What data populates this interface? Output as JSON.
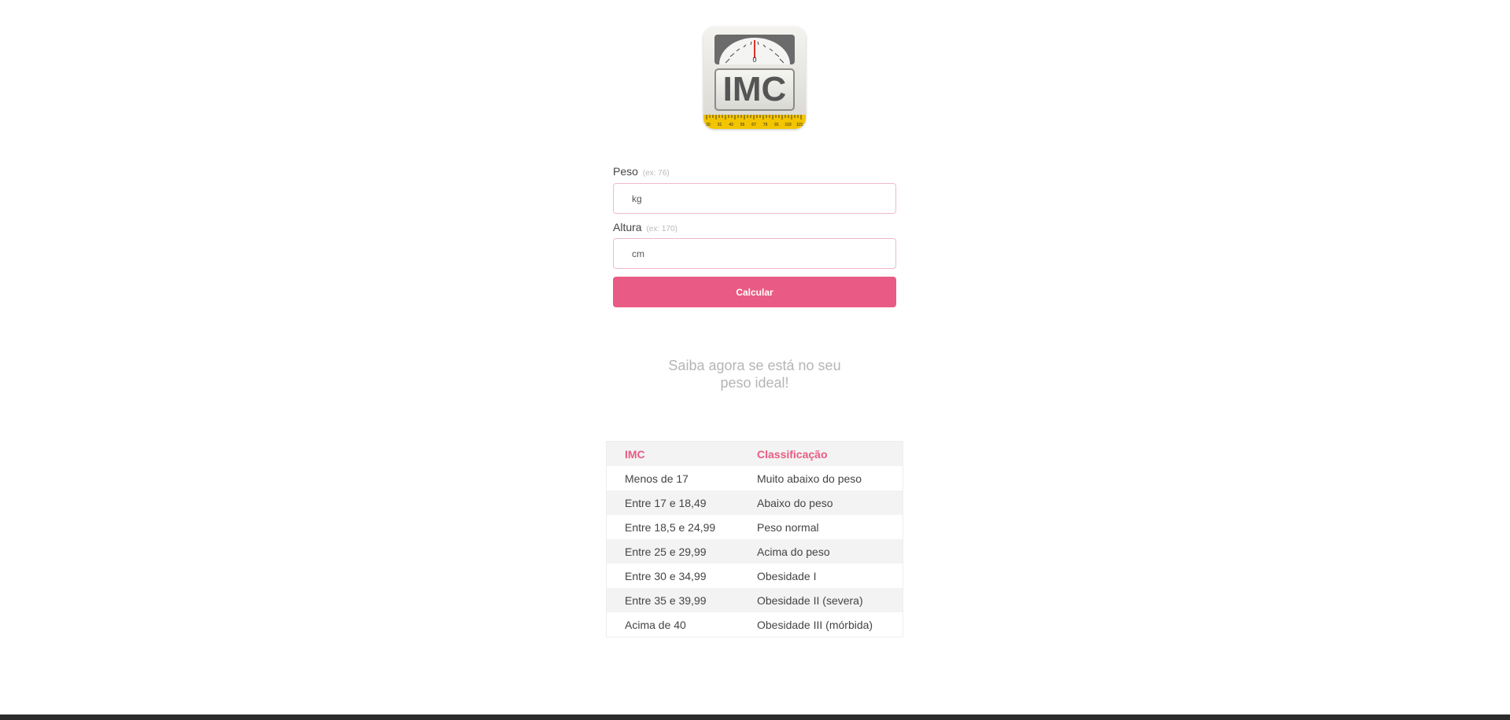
{
  "logo": {
    "text": "IMC",
    "dial_value": "0",
    "tape_marks": [
      "20",
      "31",
      "43",
      "55",
      "67",
      "79",
      "91",
      "103",
      "115"
    ]
  },
  "form": {
    "peso": {
      "label": "Peso",
      "hint": "(ex: 76)",
      "unit": "kg"
    },
    "altura": {
      "label": "Altura",
      "hint": "(ex: 170)",
      "unit": "cm"
    },
    "submit_label": "Calcular"
  },
  "tagline": "Saiba agora se está no seu peso ideal!",
  "table": {
    "headers": [
      "IMC",
      "Classificação"
    ],
    "rows": [
      [
        "Menos de 17",
        "Muito abaixo do peso"
      ],
      [
        "Entre 17 e 18,49",
        "Abaixo do peso"
      ],
      [
        "Entre 18,5 e 24,99",
        "Peso normal"
      ],
      [
        "Entre 25 e 29,99",
        "Acima do peso"
      ],
      [
        "Entre 30 e 34,99",
        "Obesidade I"
      ],
      [
        "Entre 35 e 39,99",
        "Obesidade II (severa)"
      ],
      [
        "Acima de 40",
        "Obesidade III (mórbida)"
      ]
    ]
  },
  "colors": {
    "accent": "#e95b84",
    "input_border": "#f0b9c9",
    "footer": "#2b2b2b"
  }
}
